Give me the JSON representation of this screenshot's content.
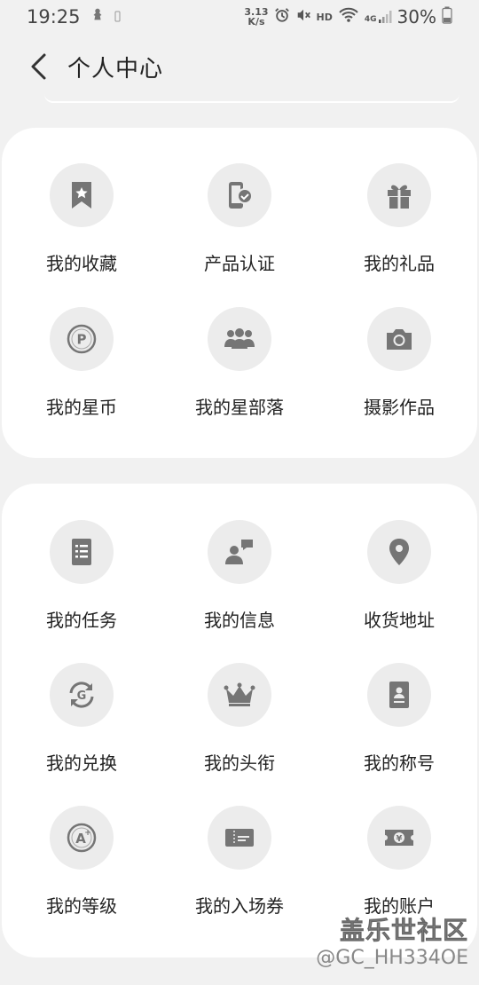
{
  "status_bar": {
    "time": "19:25",
    "net_speed_value": "3.13",
    "net_speed_unit": "K/s",
    "hd": "HD",
    "network": "4G",
    "battery": "30%"
  },
  "header": {
    "title": "个人中心"
  },
  "section1": {
    "items": [
      {
        "label": "我的收藏",
        "icon": "bookmark-star-icon"
      },
      {
        "label": "产品认证",
        "icon": "phone-check-icon"
      },
      {
        "label": "我的礼品",
        "icon": "gift-icon"
      },
      {
        "label": "我的星币",
        "icon": "coin-p-icon"
      },
      {
        "label": "我的星部落",
        "icon": "group-icon"
      },
      {
        "label": "摄影作品",
        "icon": "camera-icon"
      }
    ]
  },
  "section2": {
    "items": [
      {
        "label": "我的任务",
        "icon": "task-list-icon"
      },
      {
        "label": "我的信息",
        "icon": "user-message-icon"
      },
      {
        "label": "收货地址",
        "icon": "location-pin-icon"
      },
      {
        "label": "我的兑换",
        "icon": "exchange-g-icon"
      },
      {
        "label": "我的头衔",
        "icon": "crown-icon"
      },
      {
        "label": "我的称号",
        "icon": "badge-card-icon"
      },
      {
        "label": "我的等级",
        "icon": "level-a-plus-icon"
      },
      {
        "label": "我的入场券",
        "icon": "ticket-icon"
      },
      {
        "label": "我的账户",
        "icon": "wallet-yen-icon"
      }
    ]
  },
  "watermark": {
    "brand": "盖乐世社区",
    "user": "@GC_HH334OE"
  },
  "colors": {
    "background": "#f1f1f1",
    "card": "#ffffff",
    "icon_circle": "#ececec",
    "icon": "#757575"
  }
}
